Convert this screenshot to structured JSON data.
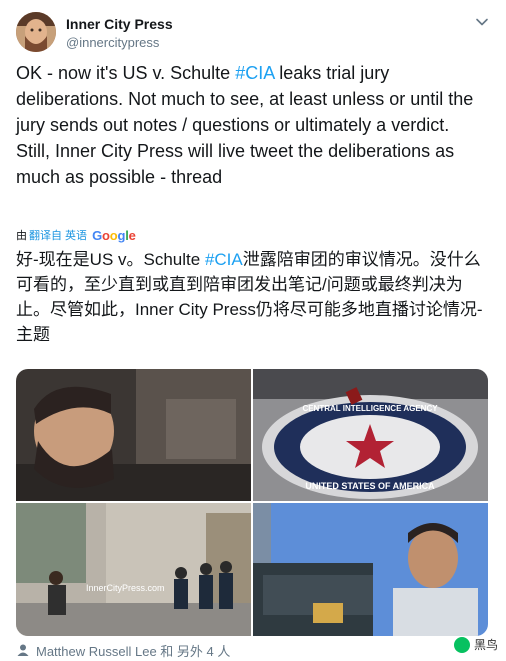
{
  "author": {
    "name": "Inner City Press",
    "handle": "@innercitypress"
  },
  "tweet": {
    "text_before_hashtag": "OK - now it's US v. Schulte ",
    "hashtag": "#CIA",
    "text_after_hashtag": " leaks trial jury deliberations. Not much to see, at least unless or until the jury sends out notes / questions or ultimately a verdict. Still, Inner City Press will live tweet the deliberations as much as possible - thread"
  },
  "translation": {
    "by_prefix": "由",
    "link_label": "翻译自 英语",
    "provider": "Google",
    "text_before_hashtag": "好-现在是US v。Schulte ",
    "hashtag": "#CIA",
    "text_after_hashtag": "泄露陪审团的审议情况。没什么可看的，至少直到或直到陪审团发出笔记/问题或最终判决为止。尽管如此，Inner City Press仍将尽可能多地直播讨论情况-主题"
  },
  "media": {
    "overlay_text": "InnerCityPress.com",
    "seal_text_top": "CENTRAL INTELLIGENCE AGENCY",
    "seal_text_bottom": "UNITED STATES OF AMERICA"
  },
  "footer": {
    "tagged_text": "Matthew Russell Lee 和 另外 4 人"
  },
  "watermark": {
    "label": "黑鸟"
  },
  "colors": {
    "link": "#1da1f2",
    "muted": "#657786",
    "text": "#14171a"
  }
}
